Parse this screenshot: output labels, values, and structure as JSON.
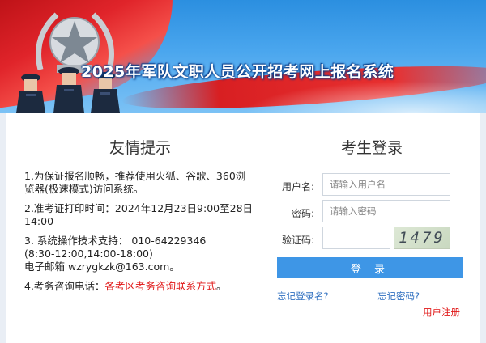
{
  "banner": {
    "title": "2025年军队文职人员公开招考网上报名系统"
  },
  "tips": {
    "title": "友情提示",
    "item1": "1.为保证报名顺畅，推荐使用火狐、谷歌、360浏览器(极速模式)访问系统。",
    "item2": "2.准考证打印时间：2024年12月23日9:00至28日14:00",
    "item3_line1": "3. 系统操作技术支持： 010-64229346",
    "item3_line2": "(8:30-12:00,14:00-18:00)",
    "item3_line3": "电子邮箱  wzrygkzk@163.com。",
    "item4_prefix": "4.考务咨询电话：",
    "item4_red": "各考区考务咨询联系方式",
    "item4_suffix": "。"
  },
  "login": {
    "title": "考生登录",
    "username_label": "用户名:",
    "username_placeholder": "请输入用户名",
    "password_label": "密码:",
    "password_placeholder": "请输入密码",
    "captcha_label": "验证码:",
    "captcha_value": "",
    "captcha_text": "1479",
    "login_button": "登 录",
    "forgot_username": "忘记登录名?",
    "forgot_password": "忘记密码?",
    "register": "用户注册"
  },
  "colors": {
    "accent": "#3e96e6",
    "link": "#2f6fc0",
    "warning": "#e01515"
  }
}
